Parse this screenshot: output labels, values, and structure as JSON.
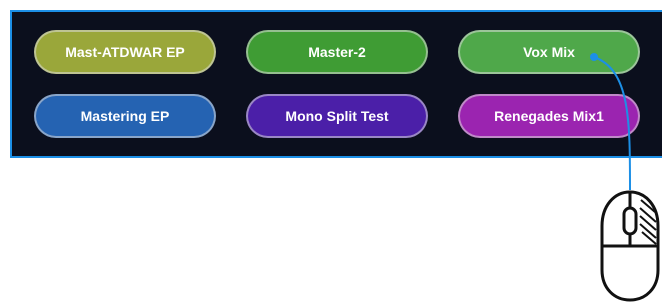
{
  "buttons": [
    {
      "label": "Mast-ATDWAR EP",
      "color": "#9aa73a"
    },
    {
      "label": "Master-2",
      "color": "#3f9c34"
    },
    {
      "label": "Vox Mix",
      "color": "#4fa84a"
    },
    {
      "label": "Mastering EP",
      "color": "#2563b2"
    },
    {
      "label": "Mono Split Test",
      "color": "#4b1fa8"
    },
    {
      "label": "Renegades Mix1",
      "color": "#9b24b0"
    }
  ],
  "panel": {
    "background": "#0b0f1d",
    "border": "#1c8fe6"
  },
  "cursor": {
    "icon": "mouse-icon",
    "cable_color": "#1c8fe6"
  }
}
